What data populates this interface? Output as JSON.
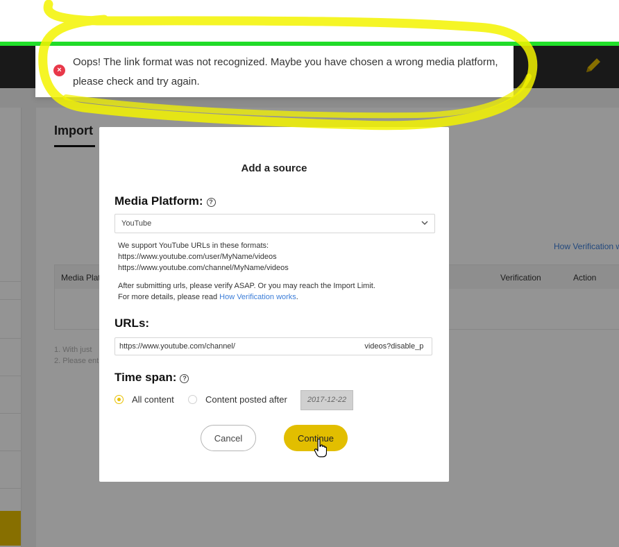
{
  "toast": {
    "icon": "error-circle-icon",
    "message": "Oops! The link format was not recognized. Maybe you have chosen a wrong media platform, please check and try again."
  },
  "background": {
    "tab_import": "Import",
    "how_verification": "How Verification w",
    "table_headers": {
      "media_platform": "Media Platf",
      "verification": "Verification",
      "action": "Action"
    },
    "notes": [
      "1. With just",
      "2. Please ent"
    ]
  },
  "modal": {
    "title": "Add a source",
    "media_platform_label": "Media Platform:",
    "platform_selected": "YouTube",
    "formats_intro": "We support YouTube URLs in these formats:",
    "formats": [
      "https://www.youtube.com/user/MyName/videos",
      "https://www.youtube.com/channel/MyName/videos"
    ],
    "verify_note": "After submitting urls, please verify ASAP. Or you may reach the Import Limit.",
    "details_prefix": "For more details, please read ",
    "details_link": "How Verification works",
    "details_suffix": ".",
    "urls_label": "URLs:",
    "url_value": "https://www.youtube.com/channel/                                                             videos?disable_p",
    "time_span_label": "Time span:",
    "option_all": "All content",
    "option_after": "Content posted after",
    "date_value": "2017-12-22",
    "cancel": "Cancel",
    "continue": "Continue"
  },
  "colors": {
    "accent": "#e2be00",
    "error": "#e8394a",
    "link": "#3b7dd8",
    "highlight_marker": "#f3f300"
  }
}
